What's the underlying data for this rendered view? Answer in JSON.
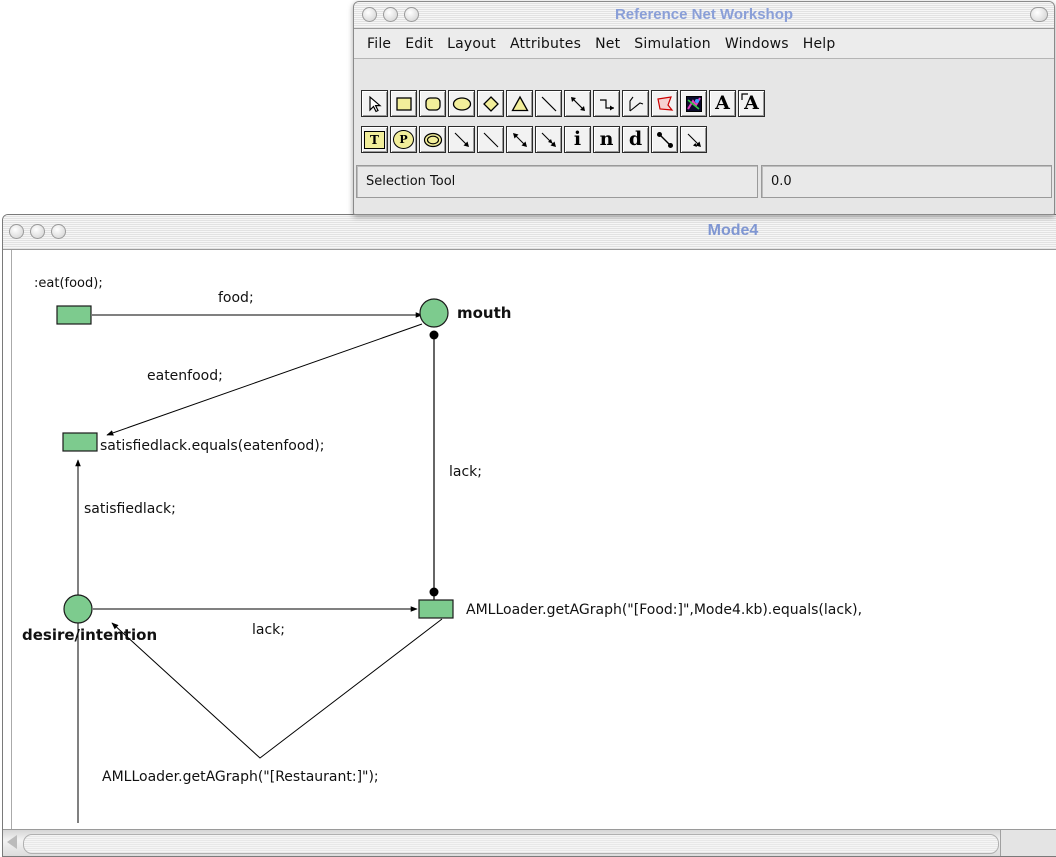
{
  "toolbar_window": {
    "title": "Reference Net Workshop",
    "menu": [
      "File",
      "Edit",
      "Layout",
      "Attributes",
      "Net",
      "Simulation",
      "Windows",
      "Help"
    ],
    "tools_row1": [
      "selection-tool",
      "rectangle-tool",
      "rounded-rectangle-tool",
      "ellipse-tool",
      "diamond-tool",
      "triangle-tool",
      "line-tool",
      "connection-tool",
      "elbow-connection-tool",
      "scribble-tool",
      "polygon-tool",
      "image-tool",
      "text-tool",
      "connected-text-tool"
    ],
    "tools_row2": [
      "transition-tool",
      "place-tool",
      "virtual-place-tool",
      "arc-tool",
      "test-arc-tool",
      "reserve-arc-tool",
      "flexible-arc-tool",
      "inscription-tool",
      "name-tool",
      "declaration-tool",
      "inhibitor-arc-tool",
      "clear-arc-tool"
    ],
    "tool_glyphs": {
      "text": "A",
      "connected_text": "A",
      "transition": "T",
      "place": "P",
      "inscription": "i",
      "name": "n",
      "declaration": "d"
    },
    "status": {
      "tool": "Selection Tool",
      "value": "0.0"
    }
  },
  "net_window": {
    "title": "Mode4",
    "places": {
      "mouth": "mouth",
      "desire": "desire/intention"
    },
    "inscriptions": {
      "eat_uplink": ":eat(food);",
      "satisfied_guard": "satisfiedlack.equals(eatenfood);",
      "aml_guard": "AMLLoader.getAGraph(\"[Food:]\",Mode4.kb).equals(lack),",
      "restaurant": "AMLLoader.getAGraph(\"[Restaurant:]\");"
    },
    "arc_labels": {
      "food": "food;",
      "eatenfood": "eatenfood;",
      "lack_vertical": "lack;",
      "satisfiedlack": "satisfiedlack;",
      "lack_horizontal": "lack;"
    },
    "colors": {
      "node_fill": "#7dcb8e",
      "node_stroke": "#1a1a1a",
      "arc": "#000000"
    }
  }
}
